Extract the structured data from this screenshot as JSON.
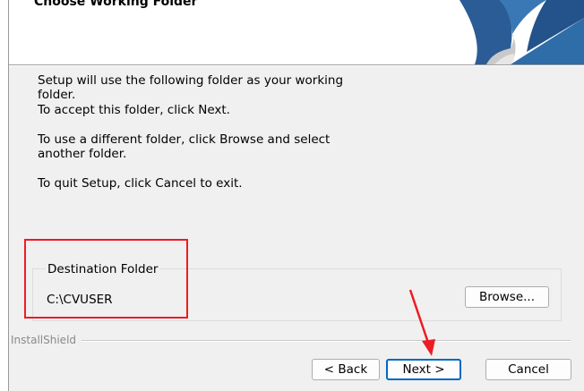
{
  "header": {
    "title": "Choose Working Folder"
  },
  "body": {
    "line1": "Setup will use the following folder as your working folder.",
    "line2": "To accept this folder, click Next.",
    "line3": "To use a different folder, click Browse and select another folder.",
    "line4": "To quit Setup, click Cancel to exit."
  },
  "destination": {
    "label": "Destination Folder",
    "path": "C:\\CVUSER",
    "browse_label": "Browse..."
  },
  "footer": {
    "brand": "InstallShield",
    "back_label": "< Back",
    "next_label": "Next >",
    "cancel_label": "Cancel"
  },
  "annotations": {
    "highlight_color": "#ed1c24",
    "arrow_color": "#ed1c24"
  },
  "icons": [
    "installshield-logo-icon",
    "red-arrow-icon"
  ]
}
